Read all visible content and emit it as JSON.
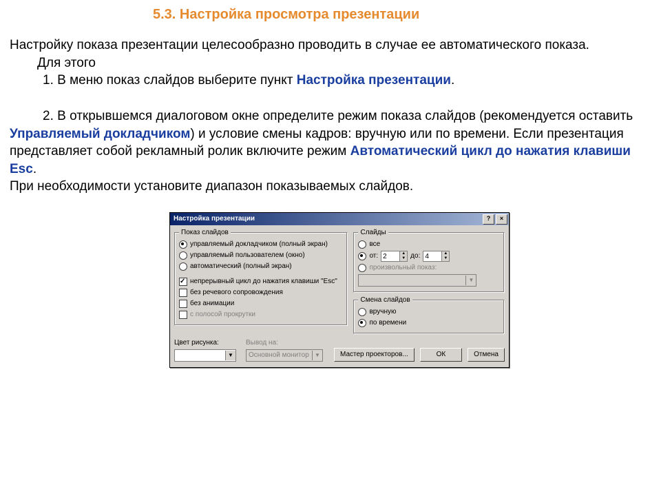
{
  "heading": "5.3.  Настройка просмотра презентации",
  "para1": "Настройку показа презентации целесообразно проводить в случае ее автоматического показа.",
  "para2": "Для этого",
  "step1_pre": "1.  В меню показ слайдов выберите пункт ",
  "step1_em": "Настройка презентации",
  "step1_post": ".",
  "step2_pre": "2.  В открывшемся диалоговом окне определите режим показа слайдов (рекомендуется оставить ",
  "step2_em1": "Управляемый докладчиком",
  "step2_mid": ") и условие смены кадров: вручную или по времени. Если презентация представляет собой рекламный ролик включите режим ",
  "step2_em2": "Автоматический цикл до нажатия клавиши Esc",
  "step2_post": ".",
  "para3": "При необходимости установите диапазон  показываемых слайдов.",
  "dialog": {
    "title": "Настройка презентации",
    "help_btn": "?",
    "close_btn": "×",
    "group_show": {
      "title": "Показ слайдов",
      "opt1": "управляемый докладчиком (полный экран)",
      "opt2": "управляемый пользователем (окно)",
      "opt3": "автоматический (полный экран)",
      "chk1": "непрерывный цикл до нажатия клавиши \"Esc\"",
      "chk2": "без речевого сопровождения",
      "chk3": "без анимации",
      "chk4": "с полосой прокрутки"
    },
    "group_slides": {
      "title": "Слайды",
      "opt_all": "все",
      "opt_from": "от:",
      "from_val": "2",
      "to_label": "до:",
      "to_val": "4",
      "opt_custom": "произвольный показ:"
    },
    "group_advance": {
      "title": "Смена слайдов",
      "opt_manual": "вручную",
      "opt_time": "по времени"
    },
    "color_label": "Цвет рисунка:",
    "output_label": "Вывод на:",
    "output_value": "Основной монитор",
    "btn_projector": "Мастер проекторов...",
    "btn_ok": "ОК",
    "btn_cancel": "Отмена"
  }
}
